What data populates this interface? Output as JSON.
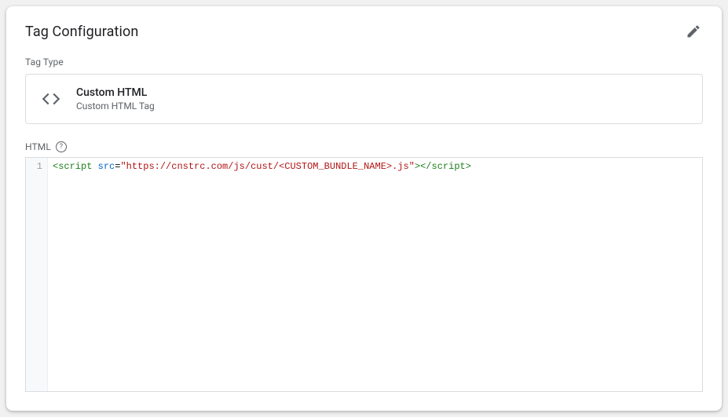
{
  "header": {
    "title": "Tag Configuration"
  },
  "tagType": {
    "label": "Tag Type",
    "name": "Custom HTML",
    "subtitle": "Custom HTML Tag"
  },
  "htmlSection": {
    "label": "HTML",
    "helpGlyph": "?",
    "lineNumber": "1",
    "code": {
      "openTag": "<script",
      "space": " ",
      "attrName": "src",
      "eq": "=",
      "attrValue": "\"https://cnstrc.com/js/cust/<CUSTOM_BUNDLE_NAME>.js\"",
      "openTagClose": ">",
      "closeTag": "</script>"
    }
  }
}
